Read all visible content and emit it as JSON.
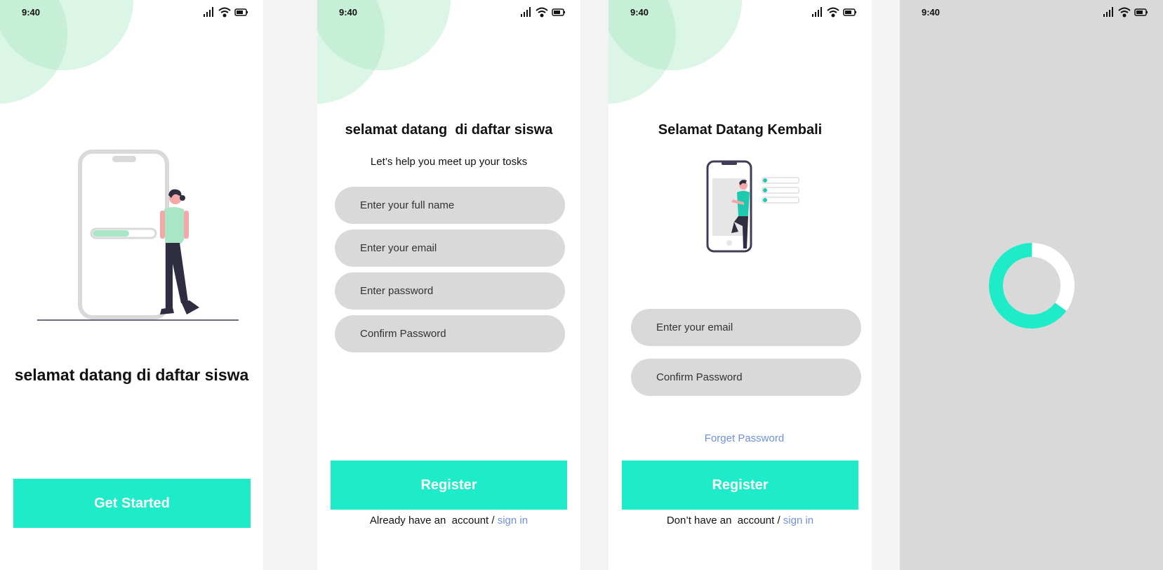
{
  "status_bar": {
    "time": "9:40"
  },
  "screen_welcome": {
    "title": "selamat datang di daftar siswa",
    "button_label": "Get Started"
  },
  "screen_register": {
    "title": "selamat datang  di daftar siswa",
    "subtitle": "Let’s help you meet up your tosks",
    "fields": [
      {
        "placeholder": "Enter your full name"
      },
      {
        "placeholder": "Enter your email"
      },
      {
        "placeholder": "Enter password"
      },
      {
        "placeholder": "Confirm Password"
      }
    ],
    "button_label": "Register",
    "footer_text": "Already have an  account / ",
    "footer_link": "sign in"
  },
  "screen_login": {
    "title": "Selamat Datang Kembali",
    "fields": [
      {
        "placeholder": "Enter your email"
      },
      {
        "placeholder": "Confirm Password"
      }
    ],
    "forget_label": "Forget Password",
    "button_label": "Register",
    "footer_text": "Don’t have an  account / ",
    "footer_link": "sign in"
  },
  "screen_loading": {
    "spinner": {
      "progress": 0.65
    }
  },
  "colors": {
    "accent": "#1eecc8",
    "link": "#6f8fe0",
    "input_bg": "#d9d9d9",
    "decor_circle": "#b0e8c8"
  },
  "icons": [
    "signal-icon",
    "wifi-icon",
    "battery-icon"
  ]
}
